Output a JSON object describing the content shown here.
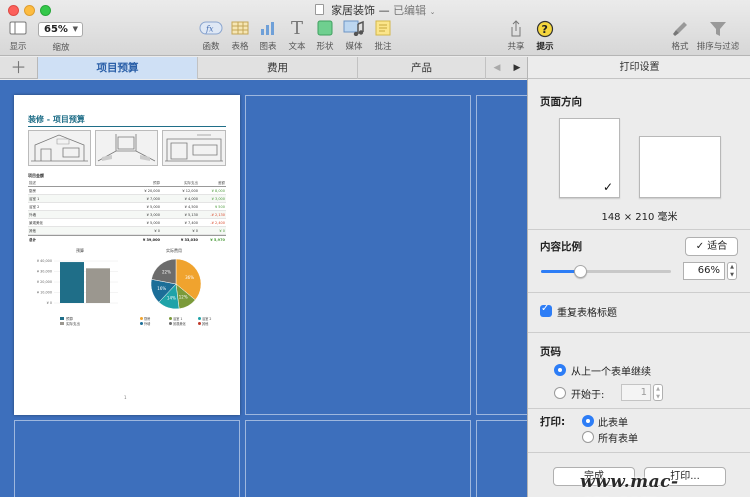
{
  "window": {
    "doc_name": "家居装饰",
    "separator": "—",
    "status": "已编辑"
  },
  "toolbar": {
    "view_label": "显示",
    "zoom_value": "65%",
    "zoom_label": "缩放",
    "function_label": "函数",
    "table_label": "表格",
    "chart_label": "图表",
    "text_label": "文本",
    "shape_label": "形状",
    "media_label": "媒体",
    "comment_label": "批注",
    "share_label": "共享",
    "tips_label": "提示",
    "format_label": "格式",
    "sort_filter_label": "排序与过滤"
  },
  "tabs": [
    {
      "label": "项目预算",
      "active": true
    },
    {
      "label": "费用",
      "active": false
    },
    {
      "label": "产品",
      "active": false
    }
  ],
  "sheet": {
    "title": "装修 - 项目预算",
    "table_title": "项目金额",
    "headers": [
      "描述",
      "预算",
      "实际支出",
      "差额"
    ],
    "rows": [
      {
        "name": "厨房",
        "budget": "¥ 20,000",
        "actual": "¥ 12,000",
        "diff": "¥ 8,000",
        "diff_color": "#4a9a3a"
      },
      {
        "name": "浴室 1",
        "budget": "¥ 7,000",
        "actual": "¥ 4,000",
        "diff": "¥ 3,000",
        "diff_color": "#4a9a3a"
      },
      {
        "name": "浴室 2",
        "budget": "¥ 5,000",
        "actual": "¥ 4,500",
        "diff": "¥ 500",
        "diff_color": "#4a9a3a"
      },
      {
        "name": "外墙",
        "budget": "¥ 3,000",
        "actual": "¥ 5,130",
        "diff": "-¥ 2,130",
        "diff_color": "#d9472a"
      },
      {
        "name": "景观美化",
        "budget": "¥ 5,000",
        "actual": "¥ 7,400",
        "diff": "-¥ 2,400",
        "diff_color": "#d9472a"
      },
      {
        "name": "其他",
        "budget": "¥ 0",
        "actual": "¥ 0",
        "diff": "¥ 0",
        "diff_color": "#4a9a3a"
      }
    ],
    "total": {
      "name": "总计",
      "budget": "¥ 39,000",
      "actual": "¥ 33,030",
      "diff": "¥ 5,970",
      "diff_color": "#4a9a3a"
    },
    "page_number": "1",
    "bar_chart": {
      "title": "预算",
      "ticks": [
        "¥ 40,000",
        "¥ 30,000",
        "¥ 20,000",
        "¥ 10,000",
        "¥ 0"
      ],
      "legend": [
        "预算",
        "实际支出"
      ]
    },
    "pie_chart": {
      "title": "实际费用",
      "slices": [
        {
          "label": "36%",
          "value": 36,
          "color": "#f0a32e"
        },
        {
          "label": "12%",
          "value": 12,
          "color": "#7b9a3a"
        },
        {
          "label": "14%",
          "value": 14,
          "color": "#1fa3a8"
        },
        {
          "label": "16%",
          "value": 16,
          "color": "#1c6e98"
        },
        {
          "label": "22%",
          "value": 22,
          "color": "#6c6c6c"
        }
      ],
      "legend": [
        "厨房",
        "浴室 1",
        "浴室 2",
        "外墙",
        "景观美化",
        "其他"
      ]
    }
  },
  "chart_data": {
    "type": "bar",
    "title": "预算",
    "categories": [
      "预算",
      "实际支出"
    ],
    "values": [
      39000,
      33030
    ],
    "ylim": [
      0,
      40000
    ],
    "colors": [
      "#1f6e88",
      "#9b978f"
    ]
  },
  "inspector": {
    "header": "打印设置",
    "orientation_label": "页面方向",
    "paper_size": "148 × 210 毫米",
    "scale_label": "内容比例",
    "fit_button": "✓ 适合",
    "scale_value": "66%",
    "scale_fraction": 0.3,
    "repeat_headers_label": "重复表格标题",
    "page_numbers_label": "页码",
    "continue_label": "从上一个表单继续",
    "start_at_label": "开始于:",
    "start_at_value": "1",
    "print_label": "打印:",
    "this_sheet_label": "此表单",
    "all_sheets_label": "所有表单",
    "done_button": "完成",
    "print_button": "打印..."
  },
  "watermark": "www.mac-gm.com"
}
